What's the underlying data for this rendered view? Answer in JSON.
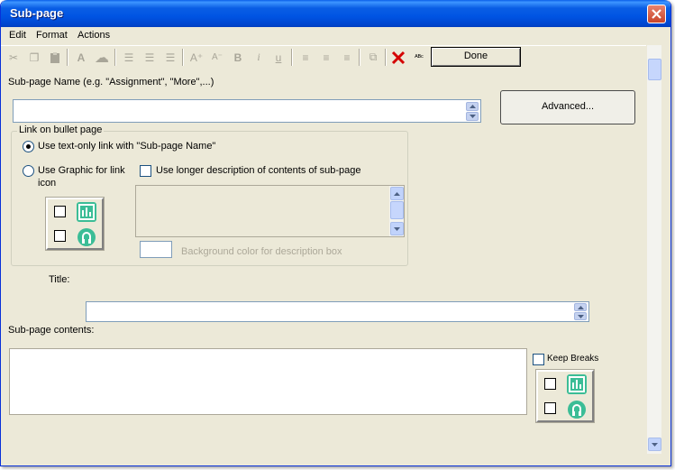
{
  "window": {
    "title": "Sub-page",
    "close_icon": "close-x-icon",
    "accent": "#0054e3",
    "close_color": "#c8442a"
  },
  "menu": {
    "items": [
      {
        "label": "Edit"
      },
      {
        "label": "Format"
      },
      {
        "label": "Actions"
      }
    ]
  },
  "toolbar": {
    "icons": [
      {
        "name": "cut-icon",
        "glyph": "✂"
      },
      {
        "name": "copy-icon",
        "glyph": "❐"
      },
      {
        "name": "paste-icon",
        "glyph": "📋"
      },
      {
        "name": "font-color-icon",
        "glyph": "A"
      },
      {
        "name": "highlight-icon",
        "glyph": "☁"
      },
      {
        "name": "bullet-list-icon",
        "glyph": "☰"
      },
      {
        "name": "numbered-list-icon",
        "glyph": "☰"
      },
      {
        "name": "outline-list-icon",
        "glyph": "☰"
      },
      {
        "name": "font-bigger-icon",
        "glyph": "A⁺"
      },
      {
        "name": "font-smaller-icon",
        "glyph": "A⁻"
      },
      {
        "name": "bold-icon",
        "glyph": "B"
      },
      {
        "name": "italic-icon",
        "glyph": "i"
      },
      {
        "name": "underline-icon",
        "glyph": "u"
      },
      {
        "name": "align-left-icon",
        "glyph": "≡"
      },
      {
        "name": "align-center-icon",
        "glyph": "≡"
      },
      {
        "name": "align-right-icon",
        "glyph": "≡"
      },
      {
        "name": "insert-link-icon",
        "glyph": "⧉"
      },
      {
        "name": "delete-icon",
        "glyph": "✕"
      },
      {
        "name": "spellcheck-icon",
        "glyph": "ᴬᴮᶜ"
      }
    ],
    "done_label": "Done"
  },
  "form": {
    "subpage_name_label": "Sub-page Name (e.g. \"Assignment\", \"More\",...)",
    "subpage_name_value": "",
    "advanced_label": "Advanced...",
    "link_group_label": "Link on bullet page",
    "radio_text_only_label": "Use text-only link with \"Sub-page Name\"",
    "radio_text_only_checked": true,
    "radio_graphic_label_line1": "Use Graphic for link",
    "radio_graphic_label_line2": "icon",
    "radio_graphic_checked": false,
    "longer_desc_label": "Use longer description of contents of sub-page",
    "longer_desc_checked": false,
    "bg_color_label": "Background color for description box",
    "title_label": "Title:",
    "title_value": "",
    "contents_label": "Sub-page contents:",
    "contents_value": "",
    "keep_breaks_label": "Keep Breaks",
    "keep_breaks_checked": false
  },
  "colors": {
    "window_bg": "#ece9d8",
    "field_border": "#7f9db9",
    "graphic_accent": "#3bbd96",
    "delete_red": "#d40000"
  }
}
